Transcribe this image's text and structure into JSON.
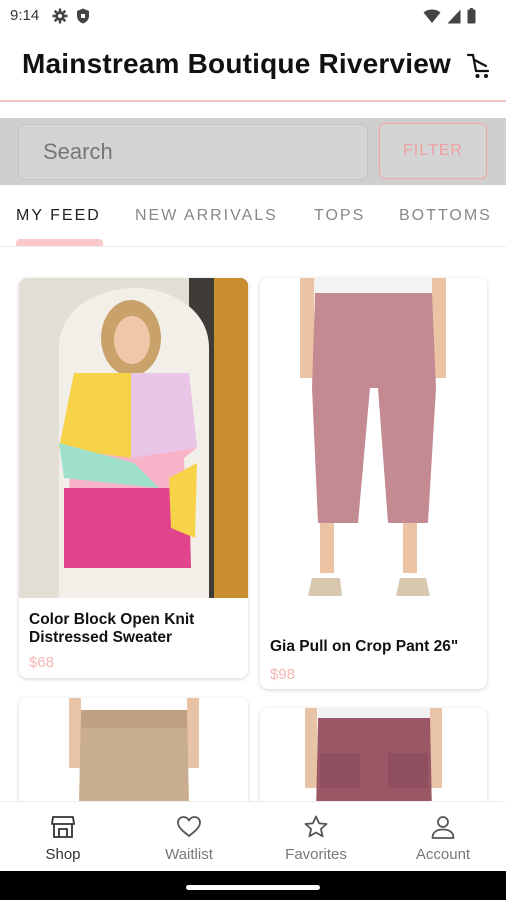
{
  "status_bar": {
    "time": "9:14",
    "icons_left": [
      "gear-icon",
      "shield-icon"
    ],
    "icons_right": [
      "wifi-icon",
      "signal-icon",
      "battery-icon"
    ]
  },
  "header": {
    "title": "Mainstream Boutique Riverview",
    "cart_icon": "cart-icon"
  },
  "search": {
    "placeholder": "Search",
    "filter_label": "FILTER"
  },
  "tabs": [
    {
      "label": "MY FEED",
      "active": true
    },
    {
      "label": "NEW ARRIVALS",
      "active": false
    },
    {
      "label": "TOPS",
      "active": false
    },
    {
      "label": "BOTTOMS",
      "active": false
    }
  ],
  "products": [
    {
      "name": "Color Block Open Knit Distressed Sweater",
      "price": "$68"
    },
    {
      "name": "Gia Pull on Crop Pant 26\"",
      "price": "$98"
    },
    {
      "name": "",
      "price": ""
    },
    {
      "name": "",
      "price": ""
    }
  ],
  "bottom_nav": [
    {
      "label": "Shop",
      "icon": "store-icon",
      "active": true
    },
    {
      "label": "Waitlist",
      "icon": "heart-icon",
      "active": false
    },
    {
      "label": "Favorites",
      "icon": "star-icon",
      "active": false
    },
    {
      "label": "Account",
      "icon": "person-icon",
      "active": false
    }
  ],
  "colors": {
    "accent_pink": "#f4a6a6",
    "price_pink": "#f6b4b4",
    "search_bg": "#cfcfcf"
  }
}
